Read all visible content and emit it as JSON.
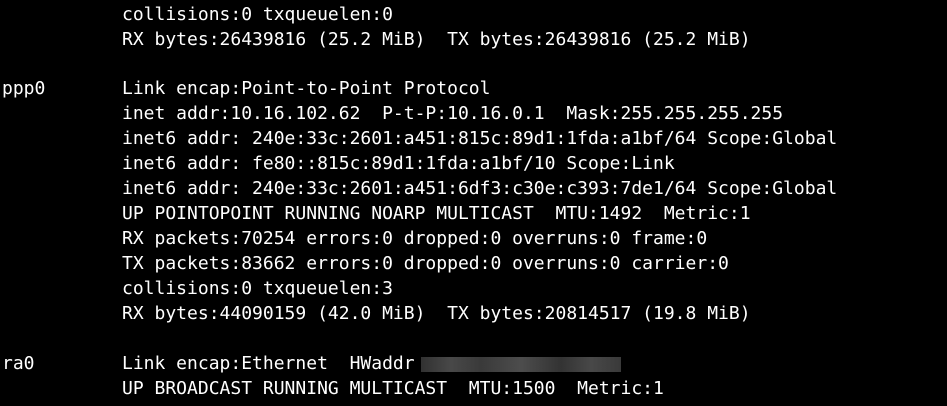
{
  "terminal": {
    "background": "#000000",
    "foreground": "#ffffff",
    "lo_tail": {
      "collisions": "collisions:0 txqueuelen:0",
      "bytes": "RX bytes:26439816 (25.2 MiB)  TX bytes:26439816 (25.2 MiB)"
    },
    "ppp0": {
      "name": "ppp0",
      "encap": "Link encap:Point-to-Point Protocol",
      "inet": "inet addr:10.16.102.62  P-t-P:10.16.0.1  Mask:255.255.255.255",
      "inet6_1": "inet6 addr: 240e:33c:2601:a451:815c:89d1:1fda:a1bf/64 Scope:Global",
      "inet6_2": "inet6 addr: fe80::815c:89d1:1fda:a1bf/10 Scope:Link",
      "inet6_3": "inet6 addr: 240e:33c:2601:a451:6df3:c30e:c393:7de1/64 Scope:Global",
      "flags": "UP POINTOPOINT RUNNING NOARP MULTICAST  MTU:1492  Metric:1",
      "rx_packets": "RX packets:70254 errors:0 dropped:0 overruns:0 frame:0",
      "tx_packets": "TX packets:83662 errors:0 dropped:0 overruns:0 carrier:0",
      "collisions": "collisions:0 txqueuelen:3",
      "bytes": "RX bytes:44090159 (42.0 MiB)  TX bytes:20814517 (19.8 MiB)"
    },
    "ra0": {
      "name": "ra0",
      "encap": "Link encap:Ethernet  HWaddr",
      "flags": "UP BROADCAST RUNNING MULTICAST  MTU:1500  Metric:1"
    }
  }
}
